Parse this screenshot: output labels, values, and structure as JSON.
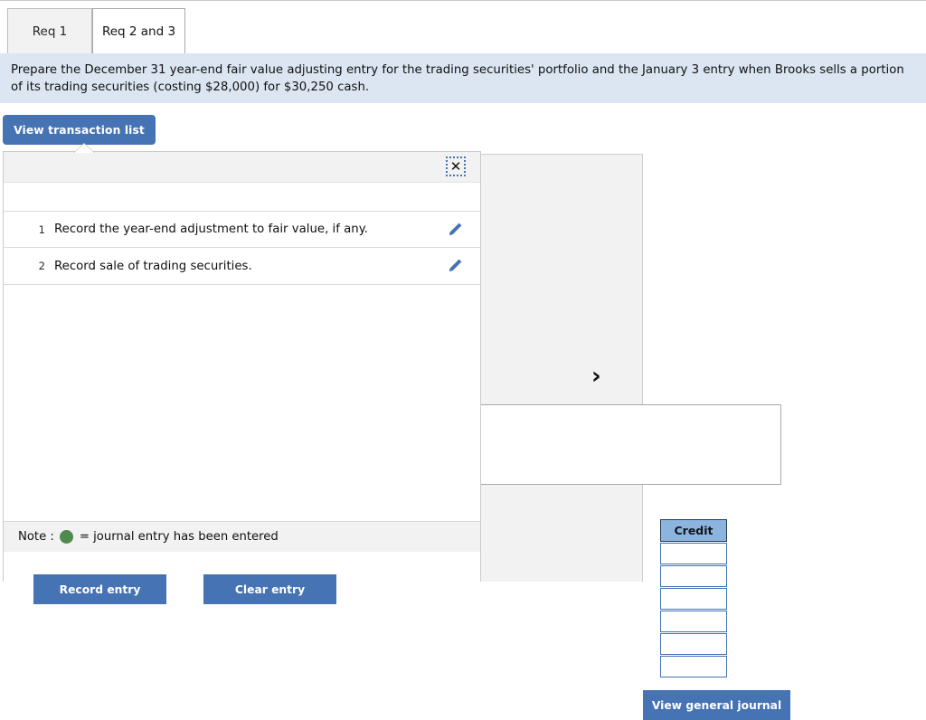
{
  "tabs": [
    {
      "label": "Req 1",
      "active": false
    },
    {
      "label": "Req 2 and 3",
      "active": true
    }
  ],
  "instruction": {
    "text": "Prepare the December 31 year-end fair value adjusting entry for the trading securities' portfolio and the January 3 entry when Brooks sells a portion of its trading securities (costing $28,000) for $30,250 cash."
  },
  "toolbar": {
    "view_transaction_list_label": "View transaction list"
  },
  "modal": {
    "close_icon": "close-icon",
    "close_glyph": "✕",
    "transactions": [
      {
        "num": "1",
        "label": "Record the year-end adjustment to fair value, if any.",
        "edit_icon": "pencil-icon"
      },
      {
        "num": "2",
        "label": "Record sale of trading securities.",
        "edit_icon": "pencil-icon"
      }
    ],
    "note": {
      "prefix": "Note :",
      "dot_color": "#4f8a4f",
      "suffix": "= journal entry has been entered"
    },
    "footer": {
      "record_entry_label": "Record entry",
      "clear_entry_label": "Clear entry"
    }
  },
  "journal_panel": {
    "next_icon": "chevron-right-icon",
    "next_glyph": "›",
    "credit_header": "Credit",
    "credit_rows": [
      "",
      "",
      "",
      "",
      "",
      ""
    ],
    "view_general_journal_label": "View general journal"
  },
  "colors": {
    "accent_blue": "#4573b3",
    "banner_blue": "#dce6f2",
    "header_blue": "#8cb4de",
    "note_green": "#4f8a4f",
    "panel_gray": "#f2f2f2"
  }
}
